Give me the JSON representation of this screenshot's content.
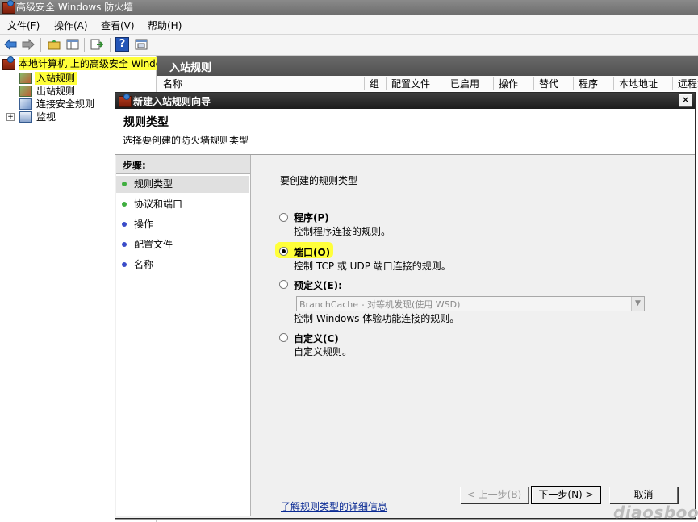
{
  "window": {
    "title": "高级安全 Windows 防火墙"
  },
  "menu": [
    "文件(F)",
    "操作(A)",
    "查看(V)",
    "帮助(H)"
  ],
  "toolbar": {
    "icons": [
      "back-arrow-icon",
      "forward-arrow-icon",
      "up-folder-icon",
      "show-hide-tree-icon",
      "export-list-icon",
      "help-icon",
      "properties-icon"
    ],
    "help_glyph": "?"
  },
  "tree": {
    "root": "本地计算机 上的高级安全 Windows",
    "items": [
      "入站规则",
      "出站规则",
      "连接安全规则",
      "监视"
    ],
    "expander": "+"
  },
  "list": {
    "title": "入站规则",
    "columns": [
      "名称",
      "组",
      "配置文件",
      "已启用",
      "操作",
      "替代",
      "程序",
      "本地地址",
      "远程地"
    ]
  },
  "wizard": {
    "title": "新建入站规则向导",
    "close_glyph": "✕",
    "header_title": "规则类型",
    "header_desc": "选择要创建的防火墙规则类型",
    "steps_title": "步骤:",
    "steps": [
      {
        "label": "规则类型",
        "color": "#3fae3f"
      },
      {
        "label": "协议和端口",
        "color": "#3fae3f"
      },
      {
        "label": "操作",
        "color": "#3a4cc9"
      },
      {
        "label": "配置文件",
        "color": "#3a4cc9"
      },
      {
        "label": "名称",
        "color": "#3a4cc9"
      }
    ],
    "prompt": "要创建的规则类型",
    "options": [
      {
        "label": "程序(P)",
        "desc": "控制程序连接的规则。",
        "checked": false
      },
      {
        "label": "端口(O)",
        "desc": "控制 TCP 或 UDP 端口连接的规则。",
        "checked": true
      },
      {
        "label": "预定义(E):",
        "desc": "控制 Windows 体验功能连接的规则。",
        "checked": false
      },
      {
        "label": "自定义(C)",
        "desc": "自定义规则。",
        "checked": false
      }
    ],
    "predefined_value": "BranchCache - 对等机发现(使用 WSD)",
    "dropdown_glyph": "▼",
    "learn_link": "了解规则类型的详细信息",
    "buttons": {
      "back": "< 上一步(B)",
      "next": "下一步(N) >",
      "cancel": "取消"
    }
  },
  "watermark": "diaosbook",
  "highlight_color": "#ffff3a"
}
